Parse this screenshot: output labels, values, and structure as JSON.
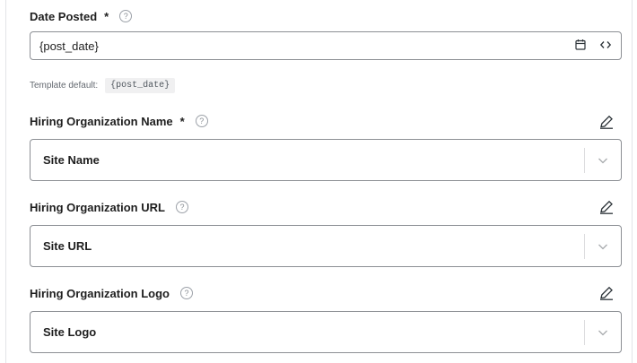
{
  "date_posted": {
    "label": "Date Posted",
    "required_mark": "*",
    "help_glyph": "?",
    "value": "{post_date}",
    "template_default_label": "Template default:",
    "template_default_value": "{post_date}",
    "icons": [
      "calendar-icon",
      "code-icon"
    ]
  },
  "hiring_org_name": {
    "label": "Hiring Organization Name",
    "required_mark": "*",
    "help_glyph": "?",
    "selected": "Site Name"
  },
  "hiring_org_url": {
    "label": "Hiring Organization URL",
    "help_glyph": "?",
    "selected": "Site URL"
  },
  "hiring_org_logo": {
    "label": "Hiring Organization Logo",
    "help_glyph": "?",
    "selected": "Site Logo"
  },
  "colors": {
    "text": "#1e1e1e",
    "border": "#8c8f94",
    "muted": "#646970",
    "icon": "#2c3338"
  }
}
